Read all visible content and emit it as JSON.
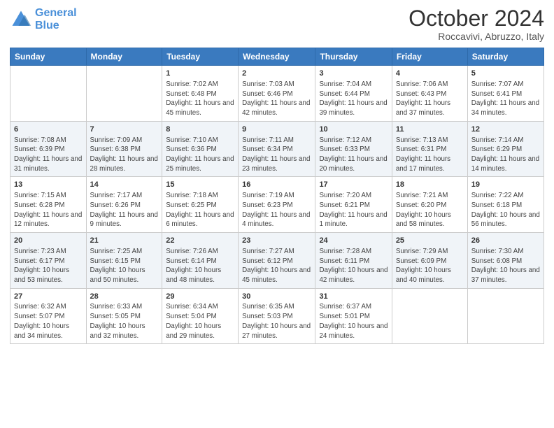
{
  "header": {
    "logo_general": "General",
    "logo_blue": "Blue",
    "month_title": "October 2024",
    "location": "Roccavivi, Abruzzo, Italy"
  },
  "weekdays": [
    "Sunday",
    "Monday",
    "Tuesday",
    "Wednesday",
    "Thursday",
    "Friday",
    "Saturday"
  ],
  "weeks": [
    [
      {
        "day": "",
        "info": ""
      },
      {
        "day": "",
        "info": ""
      },
      {
        "day": "1",
        "info": "Sunrise: 7:02 AM\nSunset: 6:48 PM\nDaylight: 11 hours and 45 minutes."
      },
      {
        "day": "2",
        "info": "Sunrise: 7:03 AM\nSunset: 6:46 PM\nDaylight: 11 hours and 42 minutes."
      },
      {
        "day": "3",
        "info": "Sunrise: 7:04 AM\nSunset: 6:44 PM\nDaylight: 11 hours and 39 minutes."
      },
      {
        "day": "4",
        "info": "Sunrise: 7:06 AM\nSunset: 6:43 PM\nDaylight: 11 hours and 37 minutes."
      },
      {
        "day": "5",
        "info": "Sunrise: 7:07 AM\nSunset: 6:41 PM\nDaylight: 11 hours and 34 minutes."
      }
    ],
    [
      {
        "day": "6",
        "info": "Sunrise: 7:08 AM\nSunset: 6:39 PM\nDaylight: 11 hours and 31 minutes."
      },
      {
        "day": "7",
        "info": "Sunrise: 7:09 AM\nSunset: 6:38 PM\nDaylight: 11 hours and 28 minutes."
      },
      {
        "day": "8",
        "info": "Sunrise: 7:10 AM\nSunset: 6:36 PM\nDaylight: 11 hours and 25 minutes."
      },
      {
        "day": "9",
        "info": "Sunrise: 7:11 AM\nSunset: 6:34 PM\nDaylight: 11 hours and 23 minutes."
      },
      {
        "day": "10",
        "info": "Sunrise: 7:12 AM\nSunset: 6:33 PM\nDaylight: 11 hours and 20 minutes."
      },
      {
        "day": "11",
        "info": "Sunrise: 7:13 AM\nSunset: 6:31 PM\nDaylight: 11 hours and 17 minutes."
      },
      {
        "day": "12",
        "info": "Sunrise: 7:14 AM\nSunset: 6:29 PM\nDaylight: 11 hours and 14 minutes."
      }
    ],
    [
      {
        "day": "13",
        "info": "Sunrise: 7:15 AM\nSunset: 6:28 PM\nDaylight: 11 hours and 12 minutes."
      },
      {
        "day": "14",
        "info": "Sunrise: 7:17 AM\nSunset: 6:26 PM\nDaylight: 11 hours and 9 minutes."
      },
      {
        "day": "15",
        "info": "Sunrise: 7:18 AM\nSunset: 6:25 PM\nDaylight: 11 hours and 6 minutes."
      },
      {
        "day": "16",
        "info": "Sunrise: 7:19 AM\nSunset: 6:23 PM\nDaylight: 11 hours and 4 minutes."
      },
      {
        "day": "17",
        "info": "Sunrise: 7:20 AM\nSunset: 6:21 PM\nDaylight: 11 hours and 1 minute."
      },
      {
        "day": "18",
        "info": "Sunrise: 7:21 AM\nSunset: 6:20 PM\nDaylight: 10 hours and 58 minutes."
      },
      {
        "day": "19",
        "info": "Sunrise: 7:22 AM\nSunset: 6:18 PM\nDaylight: 10 hours and 56 minutes."
      }
    ],
    [
      {
        "day": "20",
        "info": "Sunrise: 7:23 AM\nSunset: 6:17 PM\nDaylight: 10 hours and 53 minutes."
      },
      {
        "day": "21",
        "info": "Sunrise: 7:25 AM\nSunset: 6:15 PM\nDaylight: 10 hours and 50 minutes."
      },
      {
        "day": "22",
        "info": "Sunrise: 7:26 AM\nSunset: 6:14 PM\nDaylight: 10 hours and 48 minutes."
      },
      {
        "day": "23",
        "info": "Sunrise: 7:27 AM\nSunset: 6:12 PM\nDaylight: 10 hours and 45 minutes."
      },
      {
        "day": "24",
        "info": "Sunrise: 7:28 AM\nSunset: 6:11 PM\nDaylight: 10 hours and 42 minutes."
      },
      {
        "day": "25",
        "info": "Sunrise: 7:29 AM\nSunset: 6:09 PM\nDaylight: 10 hours and 40 minutes."
      },
      {
        "day": "26",
        "info": "Sunrise: 7:30 AM\nSunset: 6:08 PM\nDaylight: 10 hours and 37 minutes."
      }
    ],
    [
      {
        "day": "27",
        "info": "Sunrise: 6:32 AM\nSunset: 5:07 PM\nDaylight: 10 hours and 34 minutes."
      },
      {
        "day": "28",
        "info": "Sunrise: 6:33 AM\nSunset: 5:05 PM\nDaylight: 10 hours and 32 minutes."
      },
      {
        "day": "29",
        "info": "Sunrise: 6:34 AM\nSunset: 5:04 PM\nDaylight: 10 hours and 29 minutes."
      },
      {
        "day": "30",
        "info": "Sunrise: 6:35 AM\nSunset: 5:03 PM\nDaylight: 10 hours and 27 minutes."
      },
      {
        "day": "31",
        "info": "Sunrise: 6:37 AM\nSunset: 5:01 PM\nDaylight: 10 hours and 24 minutes."
      },
      {
        "day": "",
        "info": ""
      },
      {
        "day": "",
        "info": ""
      }
    ]
  ]
}
